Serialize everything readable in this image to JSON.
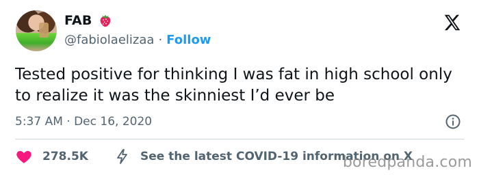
{
  "author": {
    "display_name": "FAB",
    "badge_icon": "strawberry-icon",
    "handle": "@fabiolaelizaa",
    "separator": "·",
    "follow_label": "Follow",
    "avatar_icon": "profile-photo"
  },
  "platform_icon": "x-logo-icon",
  "tweet": {
    "text": "Tested positive for thinking I was fat in high school only to realize it was the skinniest I’d ever be",
    "timestamp": "5:37 AM · Dec 16, 2020"
  },
  "actions": {
    "likes": "278.5K",
    "covid_info": "See the latest COVID-19 information on X"
  },
  "watermark": "boredpanda.com",
  "colors": {
    "link": "#1d9bf0",
    "heart": "#f91880",
    "muted": "#536471",
    "text": "#0f1419"
  }
}
